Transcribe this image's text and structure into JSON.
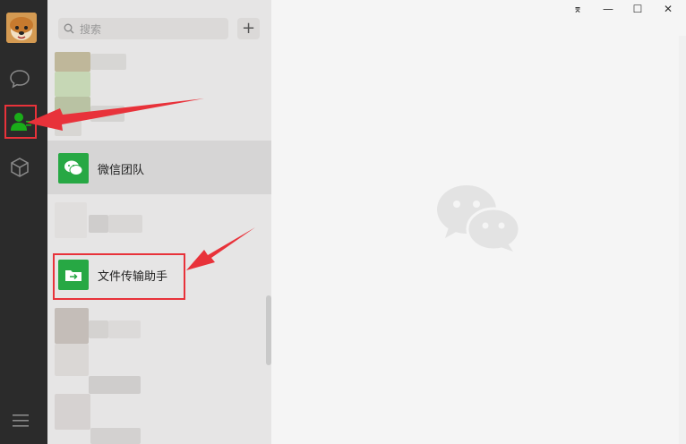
{
  "search": {
    "placeholder": "搜索",
    "icon": "search-icon"
  },
  "add_button": {
    "label": "+"
  },
  "contacts": {
    "wechat_team": {
      "name": "微信团队"
    },
    "file_helper": {
      "name": "文件传输助手"
    }
  },
  "window_controls": {
    "pin": "⌆",
    "minimize": "—",
    "maximize": "☐",
    "close": "✕"
  },
  "colors": {
    "accent_green": "#27a844",
    "highlight_red": "#e8323a",
    "sidebar": "#2b2b2b"
  }
}
